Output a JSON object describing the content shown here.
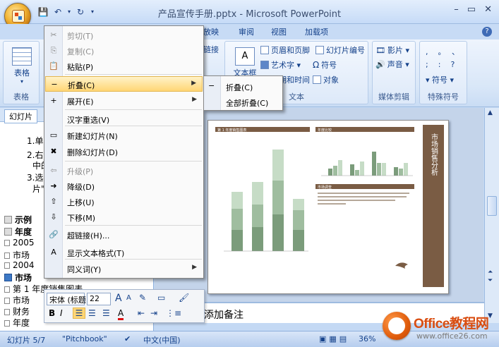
{
  "window": {
    "title": "产品宣传手册.pptx - Microsoft PowerPoint",
    "controls": [
      "–",
      "▭",
      "✕"
    ]
  },
  "ribbon_tabs": [
    {
      "label": "放映"
    },
    {
      "label": "审阅"
    },
    {
      "label": "视图"
    },
    {
      "label": "加载项"
    }
  ],
  "ribbon": {
    "table_label": "表格",
    "table_group": "表格",
    "link_fragment": "链接",
    "textbox_label": "文本框",
    "header_footer": "页眉和页脚",
    "slide_number": "幻灯片编号",
    "wordart": "艺术字",
    "symbol": "符号",
    "datetime": "日期和时间",
    "object": "对象",
    "text_group": "文本",
    "movie": "影片",
    "sound": "声音",
    "media_group": "媒体剪辑",
    "special_symbol": "符号",
    "special_group": "特殊符号",
    "punct_row1": [
      ",",
      "。",
      "、"
    ],
    "punct_row2": [
      ";",
      ":",
      "?"
    ]
  },
  "left_pane": {
    "tab_label": "幻灯片",
    "lines": [
      {
        "text": "1.单",
        "bold": false,
        "icon": ""
      },
      {
        "text": "2.右",
        "bold": false,
        "icon": ""
      },
      {
        "text": "中的",
        "bold": false,
        "icon": ""
      },
      {
        "text": "3.选",
        "bold": false,
        "icon": ""
      },
      {
        "text": "片\"",
        "bold": false,
        "icon": ""
      },
      {
        "text": "示例",
        "bold": true,
        "icon": "grey"
      },
      {
        "text": "年度",
        "bold": true,
        "icon": "grey"
      },
      {
        "text": "2005",
        "bold": false,
        "icon": "small"
      },
      {
        "text": "市场",
        "bold": false,
        "icon": "small"
      },
      {
        "text": "2004",
        "bold": false,
        "icon": "small"
      },
      {
        "text": "市场",
        "bold": true,
        "icon": "blue"
      },
      {
        "text": "第 1  年度销售图表",
        "bold": false,
        "icon": "small"
      },
      {
        "text": "市场",
        "bold": false,
        "icon": "small"
      },
      {
        "text": "财务",
        "bold": false,
        "icon": "small"
      },
      {
        "text": "年度",
        "bold": false,
        "icon": "small"
      }
    ]
  },
  "context_menu": {
    "items": [
      {
        "label": "剪切(T)",
        "icon": "✂",
        "disabled": true,
        "submenu": false
      },
      {
        "label": "复制(C)",
        "icon": "⎘",
        "disabled": true,
        "submenu": false
      },
      {
        "label": "粘贴(P)",
        "icon": "📋",
        "disabled": false,
        "submenu": false
      },
      {
        "label": "折叠(C)",
        "icon": "−",
        "disabled": false,
        "submenu": true,
        "highlight": true
      },
      {
        "label": "展开(E)",
        "icon": "+",
        "disabled": false,
        "submenu": true
      },
      {
        "label": "汉字重选(V)",
        "icon": "",
        "disabled": false,
        "submenu": false
      },
      {
        "label": "新建幻灯片(N)",
        "icon": "▭",
        "disabled": false,
        "submenu": false
      },
      {
        "label": "删除幻灯片(D)",
        "icon": "✖",
        "disabled": false,
        "submenu": false
      },
      {
        "label": "升级(P)",
        "icon": "⇦",
        "disabled": true,
        "submenu": false
      },
      {
        "label": "降级(D)",
        "icon": "➜",
        "disabled": false,
        "submenu": false
      },
      {
        "label": "上移(U)",
        "icon": "⇧",
        "disabled": false,
        "submenu": false
      },
      {
        "label": "下移(M)",
        "icon": "⇩",
        "disabled": false,
        "submenu": false
      },
      {
        "label": "超链接(H)...",
        "icon": "🔗",
        "disabled": false,
        "submenu": false
      },
      {
        "label": "显示文本格式(T)",
        "icon": "A",
        "disabled": false,
        "submenu": false
      },
      {
        "label": "同义词(Y)",
        "icon": "",
        "disabled": false,
        "submenu": true
      }
    ]
  },
  "submenu": {
    "items": [
      {
        "label": "折叠(C)",
        "icon": "−"
      },
      {
        "label": "全部折叠(C)",
        "icon": ""
      }
    ]
  },
  "mini_toolbar": {
    "font": "宋体 (标题",
    "size": "22",
    "grow": "A",
    "shrink": "A",
    "bold": "B",
    "italic": "I"
  },
  "notes": {
    "text": "添加备注"
  },
  "status": {
    "slide": "幻灯片 5/7",
    "theme": "\"Pitchbook\"",
    "lang": "中文(中国)",
    "zoom": "36%"
  },
  "slide": {
    "sidebar_text": "市场销售分析",
    "panel1_title": "第 1 年度销售图表",
    "panel2_title": "年度比较",
    "panel3_title": "市场调查"
  },
  "watermark": {
    "brand": "Office教程网",
    "url": "www.office26.com"
  },
  "colors": {
    "accent": "#7a5c44",
    "menu_highlight": "#ffd675",
    "bar_dark": "#7b9c7b",
    "bar_mid": "#9fbd9f",
    "bar_light": "#c6dcc6"
  }
}
